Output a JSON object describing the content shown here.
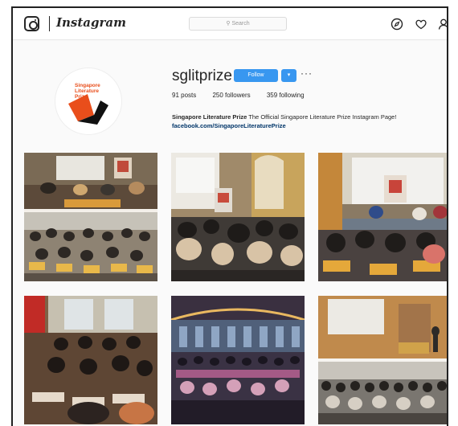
{
  "topbar": {
    "brand": "Instagram",
    "search_placeholder": "Search"
  },
  "profile": {
    "username": "sglitprize",
    "follow_label": "Follow",
    "arrow_label": "▾",
    "more_label": "···",
    "posts": "91 posts",
    "followers": "250 followers",
    "following": "359 following",
    "bio_name": "Singapore Literature Prize",
    "bio_text": " The Official Singapore Literature Prize Instagram Page!",
    "bio_link": "facebook.com/SingaporeLiteraturePrize",
    "avatar_logo_text": [
      "Singapore",
      "Literature",
      "Prize"
    ]
  },
  "posts": [
    {
      "name": "post-workshop-collage"
    },
    {
      "name": "post-dinner-event"
    },
    {
      "name": "post-panel-discussion"
    },
    {
      "name": "post-writing-session"
    },
    {
      "name": "post-auditorium-audience"
    },
    {
      "name": "post-seminar-collage"
    }
  ],
  "colors": {
    "accent": "#3897f0",
    "logo_orange": "#e94e1b",
    "link": "#003569"
  }
}
